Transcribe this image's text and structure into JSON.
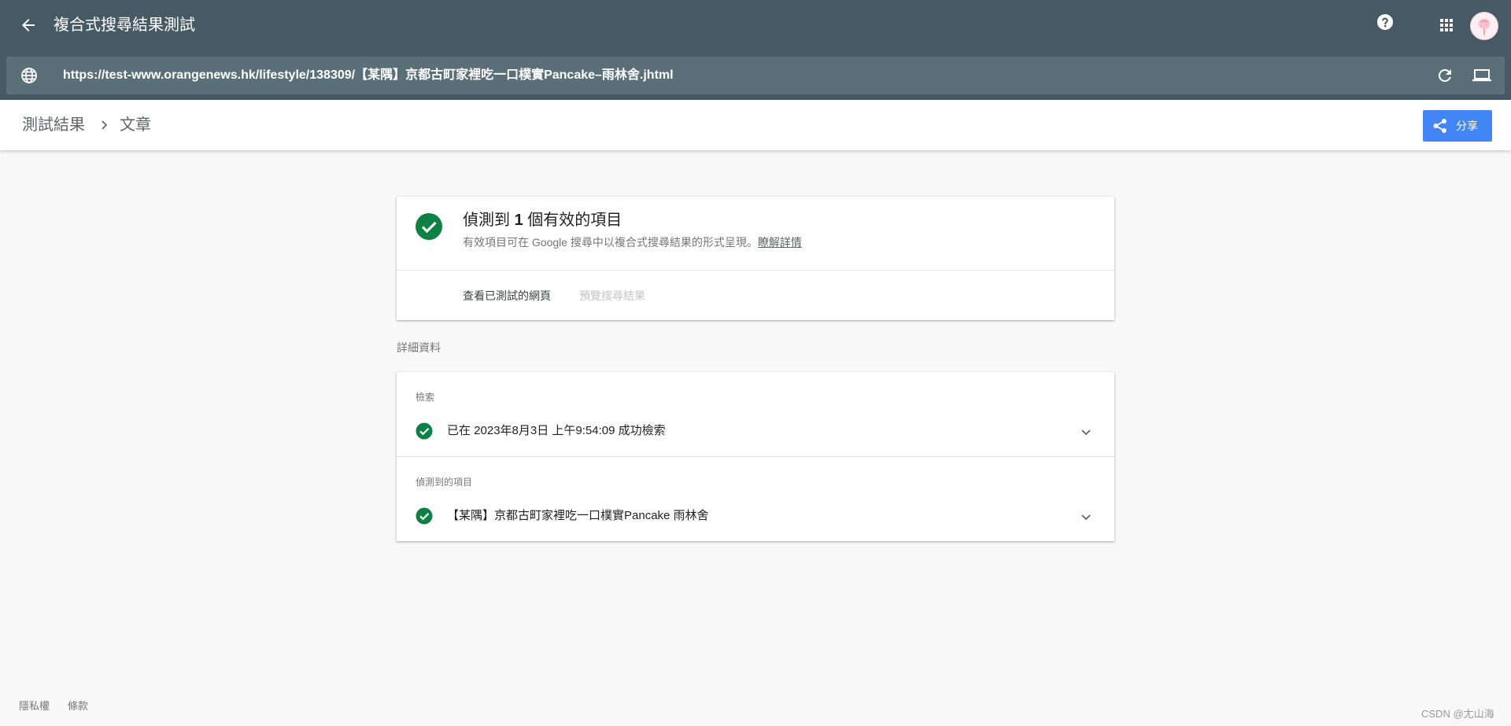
{
  "colors": {
    "appbar": "#455a64",
    "urlbar": "#5b6f79",
    "background": "#f8f8f8",
    "accent_blue": "#4285f4",
    "success_green": "#0d8043"
  },
  "header": {
    "title": "複合式搜尋結果測試",
    "back_icon": "arrow-back-icon",
    "help_icon": "help-icon",
    "apps_icon": "apps-grid-icon"
  },
  "urlbar": {
    "url": "https://test-www.orangenews.hk/lifestyle/138309/【某隅】京都古町家裡吃一口樸實Pancake–雨林舍.jhtml",
    "globe_icon": "globe-icon",
    "reload_icon": "reload-icon",
    "device_icon": "desktop-device-icon"
  },
  "breadcrumb": {
    "items": [
      "測試結果",
      "文章"
    ]
  },
  "share": {
    "label": "分享",
    "icon": "share-icon"
  },
  "summary": {
    "title_prefix": "偵測到",
    "count": "1",
    "title_suffix": "個有效的項目",
    "description": "有效項目可在 Google 搜尋中以複合式搜尋結果的形式呈現。",
    "learn_more": "瞭解詳情",
    "tabs": [
      "查看已測試的網頁",
      "預覽搜尋結果"
    ]
  },
  "details": {
    "section_label": "詳細資料",
    "rows": [
      {
        "label": "檢索",
        "text": "已在 2023年8月3日 上午9:54:09 成功檢索"
      },
      {
        "label": "偵測到的項目",
        "text": "【某隅】京都古町家裡吃一口樸實Pancake 雨林舍"
      }
    ]
  },
  "footer": {
    "links": [
      "隱私權",
      "條款"
    ]
  },
  "watermark": "CSDN @尢山海"
}
